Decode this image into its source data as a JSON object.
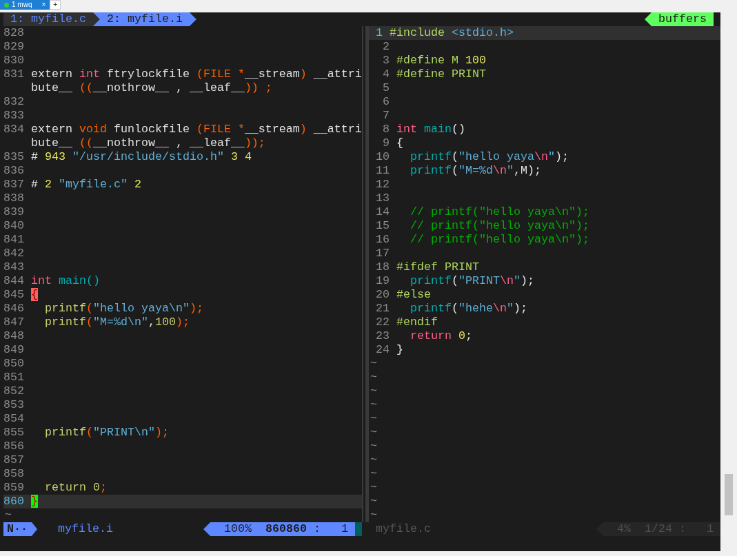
{
  "terminal_tabs": [
    {
      "label": "1 mwq",
      "selected": true,
      "close": "×"
    }
  ],
  "new_tab": "+",
  "tabline": {
    "tabs": [
      {
        "label": "1: myfile.c",
        "selected": false
      },
      {
        "label": "2: myfile.i",
        "selected": true
      }
    ],
    "right_label": "buffers"
  },
  "panes": [
    {
      "rows": [
        {
          "kind": "line",
          "number": "828",
          "current": false
        },
        {
          "kind": "line",
          "number": "829",
          "current": false
        },
        {
          "kind": "line",
          "number": "830",
          "current": false
        },
        {
          "kind": "line",
          "number": "831",
          "current": false,
          "tokens": [
            {
              "kind": "text",
              "text": "extern "
            },
            {
              "kind": "type",
              "text": "int"
            },
            {
              "kind": "text",
              "text": " ftrylockfile "
            },
            {
              "kind": "delimiter",
              "text": "(FILE *"
            },
            {
              "kind": "text",
              "text": "__stream"
            },
            {
              "kind": "delimiter",
              "text": ")"
            },
            {
              "kind": "text",
              "text": " __attri"
            }
          ]
        },
        {
          "kind": "wrap",
          "current": false,
          "tokens": [
            {
              "kind": "text",
              "text": "bute__ "
            },
            {
              "kind": "delimiter",
              "text": "(("
            },
            {
              "kind": "text",
              "text": "__nothrow__ , __leaf__"
            },
            {
              "kind": "delimiter",
              "text": ")) ;"
            }
          ]
        },
        {
          "kind": "line",
          "number": "832",
          "current": false
        },
        {
          "kind": "line",
          "number": "833",
          "current": false
        },
        {
          "kind": "line",
          "number": "834",
          "current": false,
          "tokens": [
            {
              "kind": "text",
              "text": "extern "
            },
            {
              "kind": "storage",
              "text": "void"
            },
            {
              "kind": "text",
              "text": " funlockfile "
            },
            {
              "kind": "delimiter",
              "text": "(FILE *"
            },
            {
              "kind": "text",
              "text": "__stream"
            },
            {
              "kind": "delimiter",
              "text": ")"
            },
            {
              "kind": "text",
              "text": " __attri"
            }
          ]
        },
        {
          "kind": "wrap",
          "current": false,
          "tokens": [
            {
              "kind": "text",
              "text": "bute__ "
            },
            {
              "kind": "delimiter",
              "text": "(("
            },
            {
              "kind": "text",
              "text": "__nothrow__ , __leaf__"
            },
            {
              "kind": "delimiter",
              "text": "));"
            }
          ]
        },
        {
          "kind": "line",
          "number": "835",
          "current": false,
          "tokens": [
            {
              "kind": "text",
              "text": "# "
            },
            {
              "kind": "number",
              "text": "943"
            },
            {
              "kind": "string",
              "text": " \"/usr/include/stdio.h\""
            },
            {
              "kind": "number",
              "text": " 3 4"
            }
          ]
        },
        {
          "kind": "line",
          "number": "836",
          "current": false
        },
        {
          "kind": "line",
          "number": "837",
          "current": false,
          "tokens": [
            {
              "kind": "text",
              "text": "# "
            },
            {
              "kind": "number",
              "text": "2"
            },
            {
              "kind": "string",
              "text": " \"myfile.c\""
            },
            {
              "kind": "number",
              "text": " 2"
            }
          ]
        },
        {
          "kind": "line",
          "number": "838",
          "current": false
        },
        {
          "kind": "line",
          "number": "839",
          "current": false
        },
        {
          "kind": "line",
          "number": "840",
          "current": false
        },
        {
          "kind": "line",
          "number": "841",
          "current": false
        },
        {
          "kind": "line",
          "number": "842",
          "current": false
        },
        {
          "kind": "line",
          "number": "843",
          "current": false
        },
        {
          "kind": "line",
          "number": "844",
          "current": false,
          "tokens": [
            {
              "kind": "type",
              "text": "int"
            },
            {
              "kind": "function",
              "text": " main()"
            }
          ]
        },
        {
          "kind": "line",
          "number": "845",
          "current": false,
          "tokens": [
            {
              "kind": "brace_error",
              "text": "{"
            }
          ]
        },
        {
          "kind": "line",
          "number": "846",
          "current": false,
          "tokens": [
            {
              "kind": "identifier",
              "text": "  printf"
            },
            {
              "kind": "delimiter",
              "text": "("
            },
            {
              "kind": "string",
              "text": "\"hello yaya\\n\""
            },
            {
              "kind": "delimiter",
              "text": ");"
            }
          ]
        },
        {
          "kind": "line",
          "number": "847",
          "current": false,
          "tokens": [
            {
              "kind": "identifier",
              "text": "  printf"
            },
            {
              "kind": "delimiter",
              "text": "("
            },
            {
              "kind": "string",
              "text": "\"M=%d\\n\""
            },
            {
              "kind": "text",
              "text": ","
            },
            {
              "kind": "identifier",
              "text": "100"
            },
            {
              "kind": "delimiter",
              "text": ");"
            }
          ]
        },
        {
          "kind": "line",
          "number": "848",
          "current": false
        },
        {
          "kind": "line",
          "number": "849",
          "current": false
        },
        {
          "kind": "line",
          "number": "850",
          "current": false
        },
        {
          "kind": "line",
          "number": "851",
          "current": false
        },
        {
          "kind": "line",
          "number": "852",
          "current": false
        },
        {
          "kind": "line",
          "number": "853",
          "current": false
        },
        {
          "kind": "line",
          "number": "854",
          "current": false
        },
        {
          "kind": "line",
          "number": "855",
          "current": false,
          "tokens": [
            {
              "kind": "identifier",
              "text": "  printf"
            },
            {
              "kind": "delimiter",
              "text": "("
            },
            {
              "kind": "string",
              "text": "\"PRINT\\n\""
            },
            {
              "kind": "delimiter",
              "text": ");"
            }
          ]
        },
        {
          "kind": "line",
          "number": "856",
          "current": false
        },
        {
          "kind": "line",
          "number": "857",
          "current": false
        },
        {
          "kind": "line",
          "number": "858",
          "current": false
        },
        {
          "kind": "line",
          "number": "859",
          "current": false,
          "tokens": [
            {
              "kind": "identifier",
              "text": "  return 0"
            },
            {
              "kind": "delimiter",
              "text": ";"
            }
          ]
        },
        {
          "kind": "line",
          "number": "860",
          "current": true,
          "tokens": [
            {
              "kind": "brace_match",
              "text": "}"
            }
          ]
        },
        {
          "kind": "filler",
          "text": "~",
          "current": false
        }
      ]
    },
    {
      "rows": [
        {
          "kind": "line",
          "number": "1",
          "current": true,
          "tokens": [
            {
              "kind": "preproc",
              "text": "#include"
            },
            {
              "kind": "string",
              "text": " <stdio.h>"
            }
          ]
        },
        {
          "kind": "line",
          "number": "2",
          "current": false
        },
        {
          "kind": "line",
          "number": "3",
          "current": false,
          "tokens": [
            {
              "kind": "preproc",
              "text": "#define M"
            },
            {
              "kind": "number",
              "text": " 100"
            }
          ]
        },
        {
          "kind": "line",
          "number": "4",
          "current": false,
          "tokens": [
            {
              "kind": "preproc",
              "text": "#define PRINT"
            }
          ]
        },
        {
          "kind": "line",
          "number": "5",
          "current": false
        },
        {
          "kind": "line",
          "number": "6",
          "current": false
        },
        {
          "kind": "line",
          "number": "7",
          "current": false
        },
        {
          "kind": "line",
          "number": "8",
          "current": false,
          "tokens": [
            {
              "kind": "type",
              "text": "int"
            },
            {
              "kind": "function",
              "text": " main"
            },
            {
              "kind": "text",
              "text": "()"
            }
          ]
        },
        {
          "kind": "line",
          "number": "9",
          "current": false,
          "tokens": [
            {
              "kind": "text",
              "text": "{"
            }
          ]
        },
        {
          "kind": "line",
          "number": "10",
          "current": false,
          "tokens": [
            {
              "kind": "function",
              "text": "  printf"
            },
            {
              "kind": "text",
              "text": "("
            },
            {
              "kind": "string",
              "text": "\"hello yaya"
            },
            {
              "kind": "escape",
              "text": "\\n"
            },
            {
              "kind": "string",
              "text": "\""
            },
            {
              "kind": "text",
              "text": ");"
            }
          ]
        },
        {
          "kind": "line",
          "number": "11",
          "current": false,
          "tokens": [
            {
              "kind": "function",
              "text": "  printf"
            },
            {
              "kind": "text",
              "text": "("
            },
            {
              "kind": "string",
              "text": "\"M=%d"
            },
            {
              "kind": "escape",
              "text": "\\n"
            },
            {
              "kind": "string",
              "text": "\""
            },
            {
              "kind": "text",
              "text": ",M);"
            }
          ]
        },
        {
          "kind": "line",
          "number": "12",
          "current": false
        },
        {
          "kind": "line",
          "number": "13",
          "current": false
        },
        {
          "kind": "line",
          "number": "14",
          "current": false,
          "tokens": [
            {
              "kind": "comment",
              "text": "  // printf(\"hello yaya\\n\");"
            }
          ]
        },
        {
          "kind": "line",
          "number": "15",
          "current": false,
          "tokens": [
            {
              "kind": "comment",
              "text": "  // printf(\"hello yaya\\n\");"
            }
          ]
        },
        {
          "kind": "line",
          "number": "16",
          "current": false,
          "tokens": [
            {
              "kind": "comment",
              "text": "  // printf(\"hello yaya\\n\");"
            }
          ]
        },
        {
          "kind": "line",
          "number": "17",
          "current": false
        },
        {
          "kind": "line",
          "number": "18",
          "current": false,
          "tokens": [
            {
              "kind": "preproc",
              "text": "#ifdef PRINT"
            }
          ]
        },
        {
          "kind": "line",
          "number": "19",
          "current": false,
          "tokens": [
            {
              "kind": "function",
              "text": "  printf"
            },
            {
              "kind": "text",
              "text": "("
            },
            {
              "kind": "string",
              "text": "\"PRINT"
            },
            {
              "kind": "escape",
              "text": "\\n"
            },
            {
              "kind": "string",
              "text": "\""
            },
            {
              "kind": "text",
              "text": ");"
            }
          ]
        },
        {
          "kind": "line",
          "number": "20",
          "current": false,
          "tokens": [
            {
              "kind": "preproc",
              "text": "#else"
            }
          ]
        },
        {
          "kind": "line",
          "number": "21",
          "current": false,
          "tokens": [
            {
              "kind": "function",
              "text": "  printf"
            },
            {
              "kind": "text",
              "text": "("
            },
            {
              "kind": "string",
              "text": "\"hehe"
            },
            {
              "kind": "escape",
              "text": "\\n"
            },
            {
              "kind": "string",
              "text": "\""
            },
            {
              "kind": "text",
              "text": ");"
            }
          ]
        },
        {
          "kind": "line",
          "number": "22",
          "current": false,
          "tokens": [
            {
              "kind": "preproc",
              "text": "#endif"
            }
          ]
        },
        {
          "kind": "line",
          "number": "23",
          "current": false,
          "tokens": [
            {
              "kind": "keyword",
              "text": "  return"
            },
            {
              "kind": "number",
              "text": " 0"
            },
            {
              "kind": "text",
              "text": ";"
            }
          ]
        },
        {
          "kind": "line",
          "number": "24",
          "current": false,
          "tokens": [
            {
              "kind": "text",
              "text": "}"
            }
          ]
        },
        {
          "kind": "filler",
          "text": "~",
          "current": false
        },
        {
          "kind": "filler",
          "text": "~",
          "current": false
        },
        {
          "kind": "filler",
          "text": "~",
          "current": false
        },
        {
          "kind": "filler",
          "text": "~",
          "current": false
        },
        {
          "kind": "filler",
          "text": "~",
          "current": false
        },
        {
          "kind": "filler",
          "text": "~",
          "current": false
        },
        {
          "kind": "filler",
          "text": "~",
          "current": false
        },
        {
          "kind": "filler",
          "text": "~",
          "current": false
        },
        {
          "kind": "filler",
          "text": "~",
          "current": false
        },
        {
          "kind": "filler",
          "text": "~",
          "current": false
        },
        {
          "kind": "filler",
          "text": "~",
          "current": false
        },
        {
          "kind": "filler",
          "text": "~",
          "current": false
        }
      ]
    }
  ],
  "status_bars": [
    {
      "active": true,
      "mode": "N··",
      "file": "myfile.i",
      "percent": "100%",
      "line": "860860",
      "separator": ":",
      "column": "1"
    },
    {
      "active": false,
      "file": "myfile.c",
      "percent": "4%",
      "line": "1/24",
      "separator": ":",
      "column": "1"
    }
  ]
}
